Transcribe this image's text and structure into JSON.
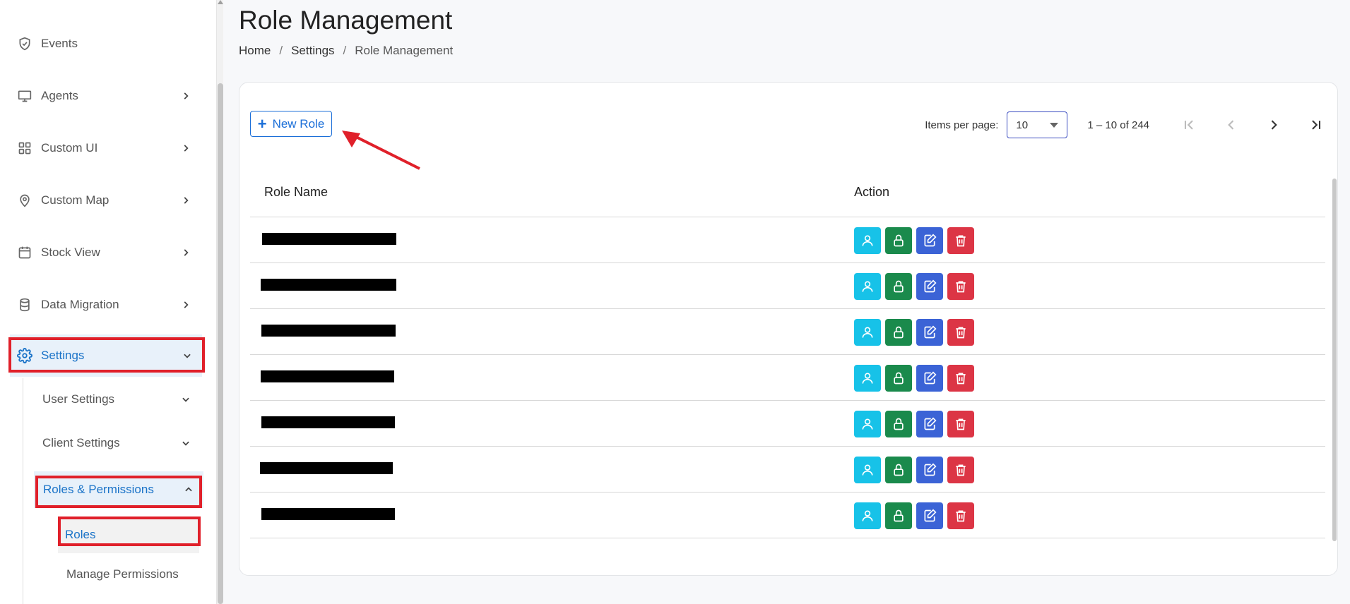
{
  "sidebar": {
    "items": [
      {
        "label": "Events",
        "icon": "shield-check-icon"
      },
      {
        "label": "Agents",
        "icon": "monitor-icon"
      },
      {
        "label": "Custom UI",
        "icon": "grid-icon"
      },
      {
        "label": "Custom Map",
        "icon": "map-pin-icon"
      },
      {
        "label": "Stock View",
        "icon": "calendar-box-icon"
      },
      {
        "label": "Data Migration",
        "icon": "database-icon"
      },
      {
        "label": "Settings",
        "icon": "gear-icon"
      }
    ],
    "settings_sub": {
      "user_settings": "User Settings",
      "client_settings": "Client Settings",
      "roles_permissions": "Roles & Permissions",
      "roles": "Roles",
      "manage_permissions": "Manage Permissions"
    }
  },
  "header": {
    "title": "Role Management",
    "breadcrumb": [
      "Home",
      "Settings",
      "Role Management"
    ]
  },
  "toolbar": {
    "new_role_label": "New Role"
  },
  "pager": {
    "items_per_page_label": "Items per page:",
    "items_per_page_value": "10",
    "range": "1 – 10 of 244"
  },
  "table": {
    "columns": [
      "Role Name",
      "Action"
    ],
    "rows": [
      {
        "redacted": true
      },
      {
        "redacted": true
      },
      {
        "redacted": true
      },
      {
        "redacted": true
      },
      {
        "redacted": true
      },
      {
        "redacted": true
      },
      {
        "redacted": true
      }
    ],
    "action_icons": [
      "user-icon",
      "lock-icon",
      "edit-icon",
      "trash-icon"
    ]
  },
  "colors": {
    "accent": "#1a73c8",
    "highlight": "#e0202a",
    "action_user": "#17c2e8",
    "action_lock": "#1a8a4c",
    "action_edit": "#3b63d6",
    "action_delete": "#dc3545"
  }
}
